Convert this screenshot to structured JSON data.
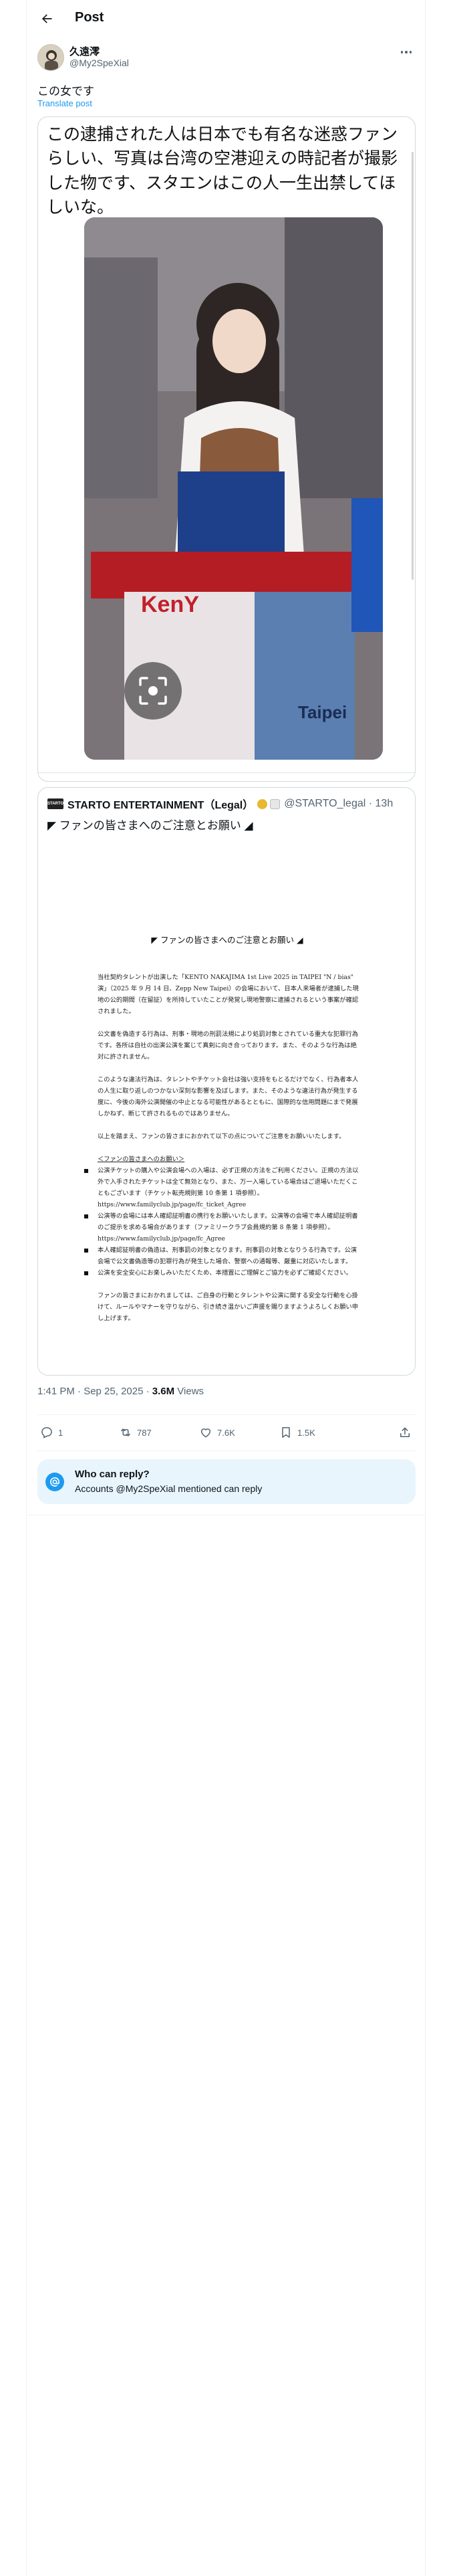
{
  "header": {
    "title": "Post"
  },
  "author": {
    "name": "久遠澪",
    "handle": "@My2SpeXial"
  },
  "tweet": {
    "text": "この女です",
    "translate_label": "Translate post"
  },
  "quoted_image_text": "この逮捕された人は日本でも有名な迷惑ファンらしい、写真は台湾の空港迎えの時記者が撮影した物です、スタエンはこの人一生出禁してほしいな。",
  "photo": {
    "sign_text_1": "KenY",
    "sign_text_2": "Taipei"
  },
  "quoted_post": {
    "author_name": "STARTO ENTERTAINMENT（Legal）",
    "author_handle": "@STARTO_legal",
    "time": "13h",
    "headline": "◤ ファンの皆さまへのご注意とお願い ◢"
  },
  "document": {
    "title": "◤ ファンの皆さまへのご注意とお願い ◢",
    "paragraphs": [
      "当社契約タレントが出演した「KENTO NAKAJIMA 1st Live 2025 in TAIPEI \"N / bias\" 演」（2025 年 9 月 14 日、Zepp New Taipei）の会場において、日本人来場者が逮捕した現地の公的期間（在留証）を所持していたことが発覚し現地警察に逮捕されるという事案が確認されました。",
      "公文書を偽造する行為は、刑事・現地の刑罰法規により処罰対象とされている重大な犯罪行為です。各所は自社の出演公演を案じて真剣に向き合っております。また、そのような行為は絶対に許されません。",
      "このような違法行為は、タレントやチケット会社は強い支持をもとるだけでなく、行為者本人の人生に取り返しのつかない深刻な影響を及ぼします。また、そのような違法行為が発生する度に、今後の海外公演開催の中止となる可能性があるとともに、国際的な信用問題にまで発展しかねず、断じて許されるものではありません。",
      "以上を踏まえ、ファンの皆さまにおかれて以下の点についてご注意をお願いいたします。"
    ],
    "list_heading": "＜ファンの皆さまへのお願い＞",
    "bullets": [
      "公演チケットの購入や公演会場への入場は、必ず正規の方法をご利用ください。正規の方法以外で入手されたチケットは全て無効となり、また、万一入場している場合はご退場いただくこともございます（チケット転売規則第 10 条第 1 項参照）。 https://www.familyclub.jp/page/fc_ticket_Agree",
      "公演等の会場には本人確認証明書の携行をお願いいたします。公演等の会場で本人確認証明書のご提示を求める場合があります（ファミリークラブ会員規約第 8 条第 1 項参照）。 https://www.familyclub.jp/page/fc_Agree",
      "本人確認証明書の偽造は、刑事罰の対象となります。刑事罰の対象となりうる行為です。公演会場で公文書偽造等の犯罪行為が発生した場合、警察への通報等、厳重に対応いたします。",
      "公演を安全安心にお楽しみいただくため、本措置にご理解とご協力を必ずご確認ください。"
    ],
    "closing": "ファンの皆さまにおかれましては、ご自身の行動とタレントや公演に関する安全な行動を心掛けて、ルールやマナーを守りながら、引き続き温かいご声援を賜りますようよろしくお願い申し上げます。"
  },
  "meta": {
    "time": "1:41 PM · Sep 25, 2025 · ",
    "views_count": "3.6M",
    "views_label": " Views"
  },
  "actions": {
    "replies": "1",
    "reposts": "787",
    "likes": "7.6K",
    "bookmarks": "1.5K"
  },
  "reply_restriction": {
    "title": "Who can reply?",
    "description": "Accounts @My2SpeXial mentioned can reply"
  },
  "colors": {
    "accent": "#1d9bf0",
    "text": "#0f1419",
    "muted": "#536471",
    "reply_box_bg": "#e8f5fd"
  },
  "icons": [
    "back-arrow-icon",
    "more-icon",
    "image-search-icon",
    "reply-icon",
    "repost-icon",
    "like-icon",
    "bookmark-icon",
    "share-icon",
    "at-sign-icon"
  ]
}
